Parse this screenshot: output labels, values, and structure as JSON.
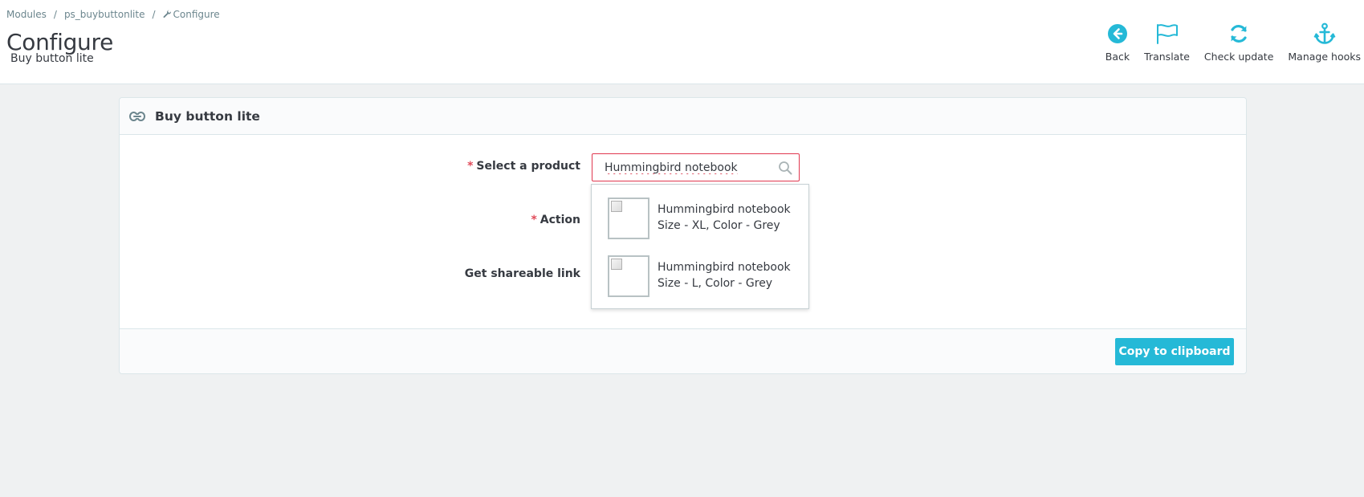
{
  "breadcrumb": {
    "items": [
      "Modules",
      "ps_buybuttonlite",
      "Configure"
    ],
    "separator": "/"
  },
  "header": {
    "title": "Configure",
    "subtitle": "Buy button lite"
  },
  "toolbar": {
    "back": {
      "label": "Back",
      "icon": "back-circle-icon"
    },
    "translate": {
      "label": "Translate",
      "icon": "flag-icon"
    },
    "check_update": {
      "label": "Check update",
      "icon": "refresh-icon"
    },
    "manage_hooks": {
      "label": "Manage hooks",
      "icon": "anchor-icon"
    }
  },
  "panel": {
    "title": "Buy button lite",
    "icon": "link-icon",
    "fields": {
      "product": {
        "label": "Select a product",
        "required": "*",
        "value": "Hummingbird notebook"
      },
      "action": {
        "label": "Action",
        "required": "*"
      },
      "link": {
        "label": "Get shareable link"
      }
    },
    "suggestions": [
      {
        "name": "Hummingbird notebook",
        "attributes": "Size - XL, Color - Grey"
      },
      {
        "name": "Hummingbird notebook",
        "attributes": "Size - L, Color - Grey"
      }
    ],
    "footer": {
      "copy_button": "Copy to clipboard"
    }
  },
  "colors": {
    "accent": "#25b9d7",
    "required": "#e04a59",
    "error_border": "#e0384f",
    "background": "#eff1f2"
  }
}
